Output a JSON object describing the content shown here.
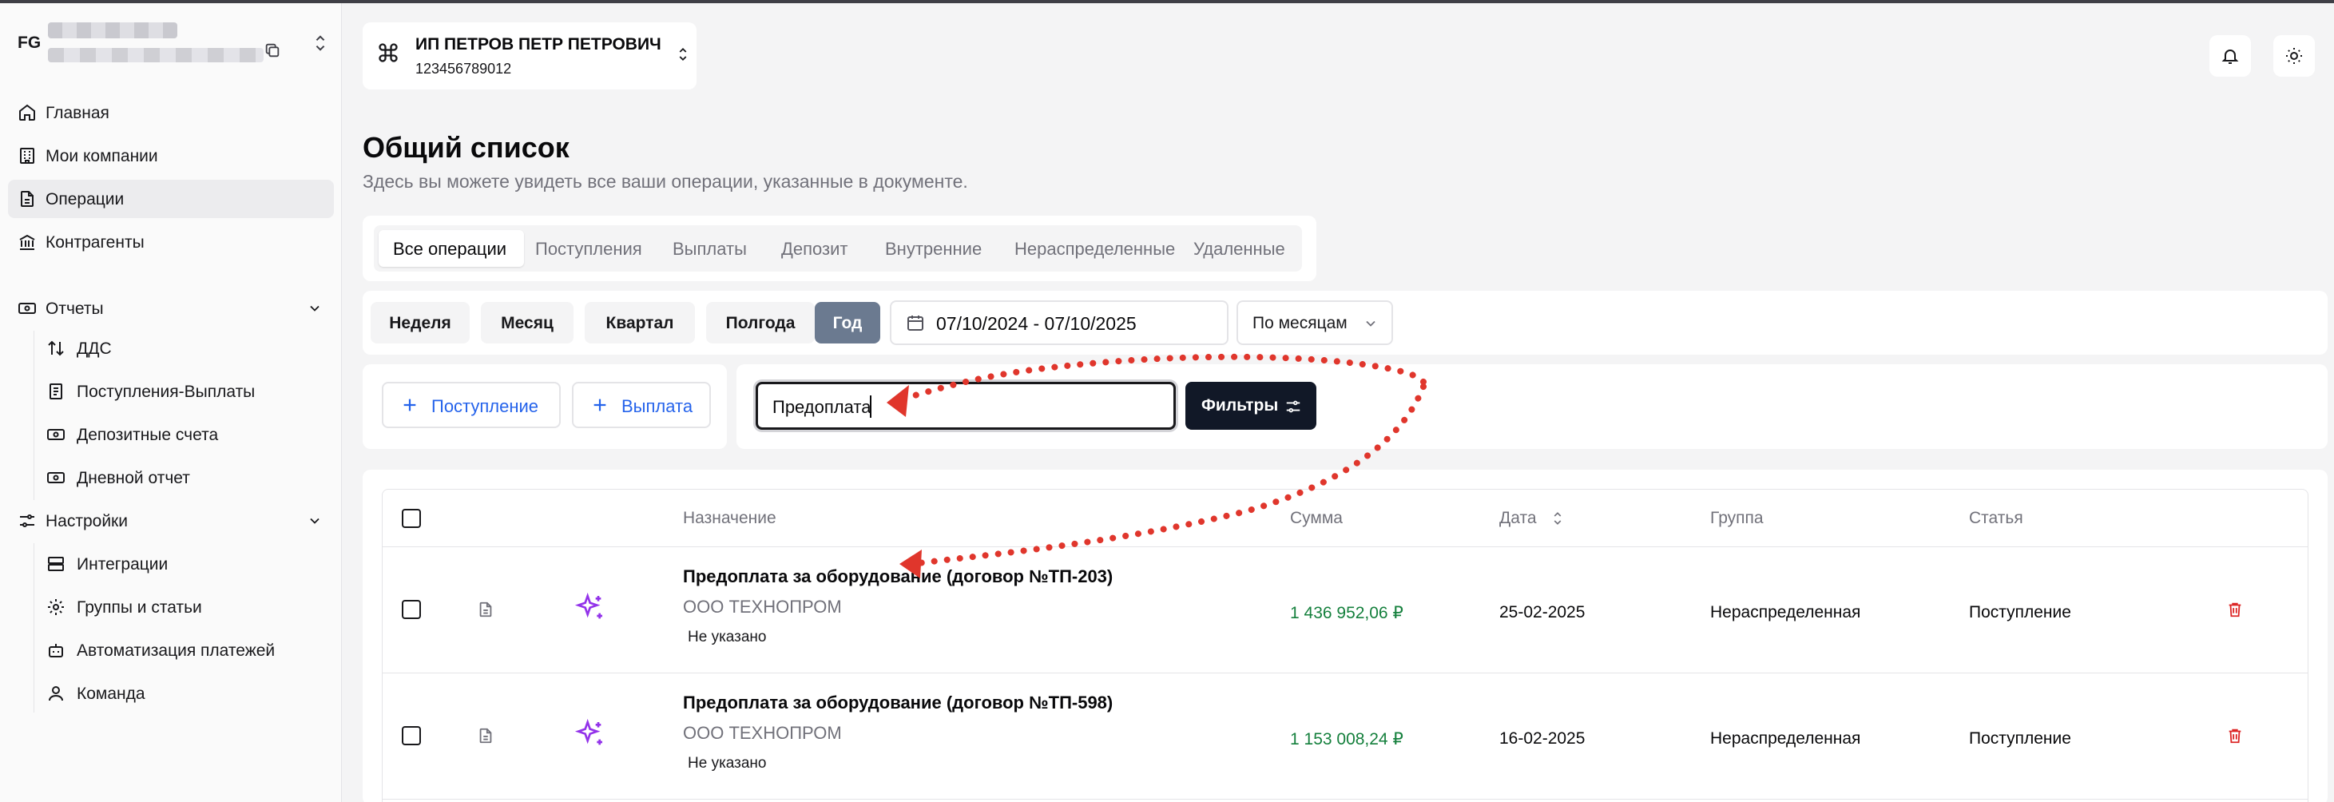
{
  "user": {
    "initials": "FG"
  },
  "sidebar": {
    "items": [
      {
        "label": "Главная",
        "icon": "home-icon"
      },
      {
        "label": "Мои компании",
        "icon": "building-icon"
      },
      {
        "label": "Операции",
        "icon": "document-icon",
        "active": true
      },
      {
        "label": "Контрагенты",
        "icon": "bank-icon"
      }
    ],
    "reports": {
      "label": "Отчеты",
      "items": [
        "ДДС",
        "Поступления-Выплаты",
        "Депозитные счета",
        "Дневной отчет"
      ]
    },
    "settings": {
      "label": "Настройки",
      "items": [
        "Интеграции",
        "Группы и статьи",
        "Автоматизация платежей",
        "Команда"
      ]
    }
  },
  "company": {
    "name": "ИП ПЕТРОВ ПЕТР ПЕТРОВИЧ",
    "inn": "123456789012"
  },
  "page": {
    "title": "Общий список",
    "subtitle": "Здесь вы можете увидеть все ваши операции, указанные в документе."
  },
  "tabs": [
    "Все операции",
    "Поступления",
    "Выплаты",
    "Депозит",
    "Внутренние",
    "Нераспределенные",
    "Удаленные"
  ],
  "period": {
    "buttons": [
      "Неделя",
      "Месяц",
      "Квартал",
      "Полгода",
      "Год"
    ],
    "active": "Год",
    "date_range": "07/10/2024 - 07/10/2025",
    "grouping": "По месяцам"
  },
  "actions": {
    "income": "Поступление",
    "payment": "Выплата"
  },
  "search": {
    "value": "Предоплата",
    "filters_label": "Фильтры"
  },
  "table": {
    "columns": {
      "purpose": "Назначение",
      "amount": "Сумма",
      "date": "Дата",
      "group": "Группа",
      "article": "Статья"
    },
    "rows": [
      {
        "title": "Предоплата за оборудование (договор №ТП-203)",
        "counterparty": "ООО ТЕХНОПРОМ",
        "note": "Не указано",
        "amount": "1 436 952,06 ₽",
        "date": "25-02-2025",
        "group": "Нераспределенная",
        "article": "Поступление"
      },
      {
        "title": "Предоплата за оборудование (договор №ТП-598)",
        "counterparty": "ООО ТЕХНОПРОМ",
        "note": "Не указано",
        "amount": "1 153 008,24 ₽",
        "date": "16-02-2025",
        "group": "Нераспределенная",
        "article": "Поступление"
      }
    ]
  },
  "colors": {
    "accent_blue": "#2563eb",
    "amount_green": "#15803d",
    "delete_red": "#dc2626",
    "ai_purple": "#9333ea",
    "annotation_red": "#e0362c",
    "active_period": "#6b7a90"
  }
}
